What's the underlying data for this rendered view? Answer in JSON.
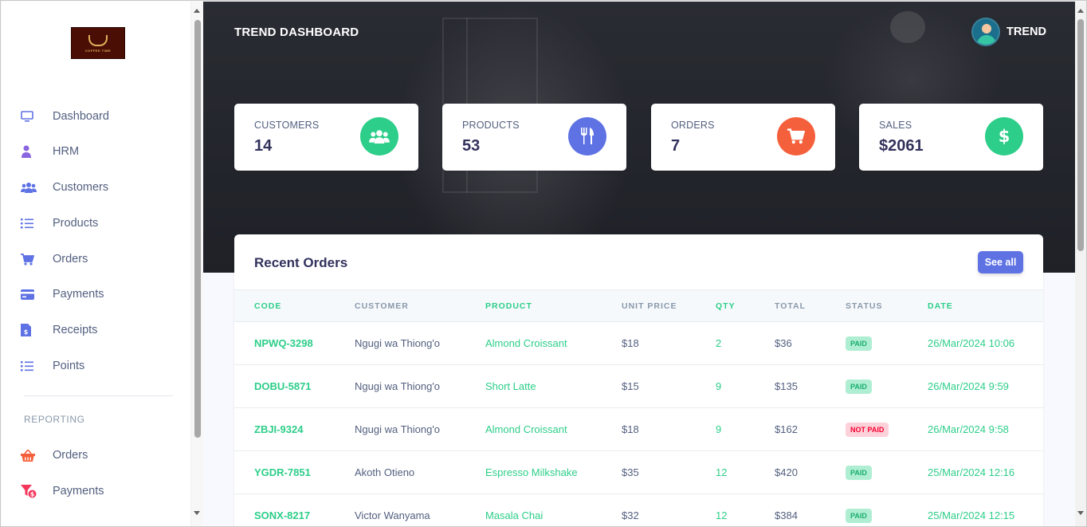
{
  "sidebar": {
    "logo_text": "COFFEE TIME",
    "items": [
      {
        "label": "Dashboard",
        "icon": "monitor-icon"
      },
      {
        "label": "HRM",
        "icon": "user-tie-icon"
      },
      {
        "label": "Customers",
        "icon": "users-icon"
      },
      {
        "label": "Products",
        "icon": "list-icon"
      },
      {
        "label": "Orders",
        "icon": "cart-icon"
      },
      {
        "label": "Payments",
        "icon": "credit-card-icon"
      },
      {
        "label": "Receipts",
        "icon": "receipt-icon"
      },
      {
        "label": "Points",
        "icon": "list-icon"
      }
    ],
    "reporting_label": "REPORTING",
    "reporting_items": [
      {
        "label": "Orders",
        "icon": "basket-icon"
      },
      {
        "label": "Payments",
        "icon": "funnel-dollar-icon"
      }
    ]
  },
  "header": {
    "brand": "TREND DASHBOARD",
    "user_name": "TREND"
  },
  "stats": [
    {
      "title": "CUSTOMERS",
      "value": "14",
      "icon": "users-icon",
      "color": "#2dce89"
    },
    {
      "title": "PRODUCTS",
      "value": "53",
      "icon": "utensils-icon",
      "color": "#5e72e4"
    },
    {
      "title": "ORDERS",
      "value": "7",
      "icon": "cart-icon",
      "color": "#f5603c"
    },
    {
      "title": "SALES",
      "value": "$2061",
      "icon": "dollar-icon",
      "color": "#2dce89"
    }
  ],
  "recent_orders": {
    "title": "Recent Orders",
    "see_all_label": "See all",
    "columns": [
      "CODE",
      "CUSTOMER",
      "PRODUCT",
      "UNIT PRICE",
      "QTY",
      "TOTAL",
      "STATUS",
      "DATE"
    ],
    "rows": [
      {
        "code": "NPWQ-3298",
        "customer": "Ngugi wa Thiong'o",
        "product": "Almond Croissant",
        "unit_price": "$18",
        "qty": "2",
        "total": "$36",
        "status": "PAID",
        "date": "26/Mar/2024 10:06"
      },
      {
        "code": "DOBU-5871",
        "customer": "Ngugi wa Thiong'o",
        "product": "Short Latte",
        "unit_price": "$15",
        "qty": "9",
        "total": "$135",
        "status": "PAID",
        "date": "26/Mar/2024 9:59"
      },
      {
        "code": "ZBJI-9324",
        "customer": "Ngugi wa Thiong'o",
        "product": "Almond Croissant",
        "unit_price": "$18",
        "qty": "9",
        "total": "$162",
        "status": "NOT PAID",
        "date": "26/Mar/2024 9:58"
      },
      {
        "code": "YGDR-7851",
        "customer": "Akoth Otieno",
        "product": "Espresso Milkshake",
        "unit_price": "$35",
        "qty": "12",
        "total": "$420",
        "status": "PAID",
        "date": "25/Mar/2024 12:16"
      },
      {
        "code": "SONX-8217",
        "customer": "Victor Wanyama",
        "product": "Masala Chai",
        "unit_price": "$32",
        "qty": "12",
        "total": "$384",
        "status": "PAID",
        "date": "25/Mar/2024 12:15"
      }
    ]
  },
  "colors": {
    "primary": "#5e72e4",
    "success": "#2dce89",
    "danger": "#f5603c",
    "text": "#525f7f",
    "heading": "#32325d"
  }
}
